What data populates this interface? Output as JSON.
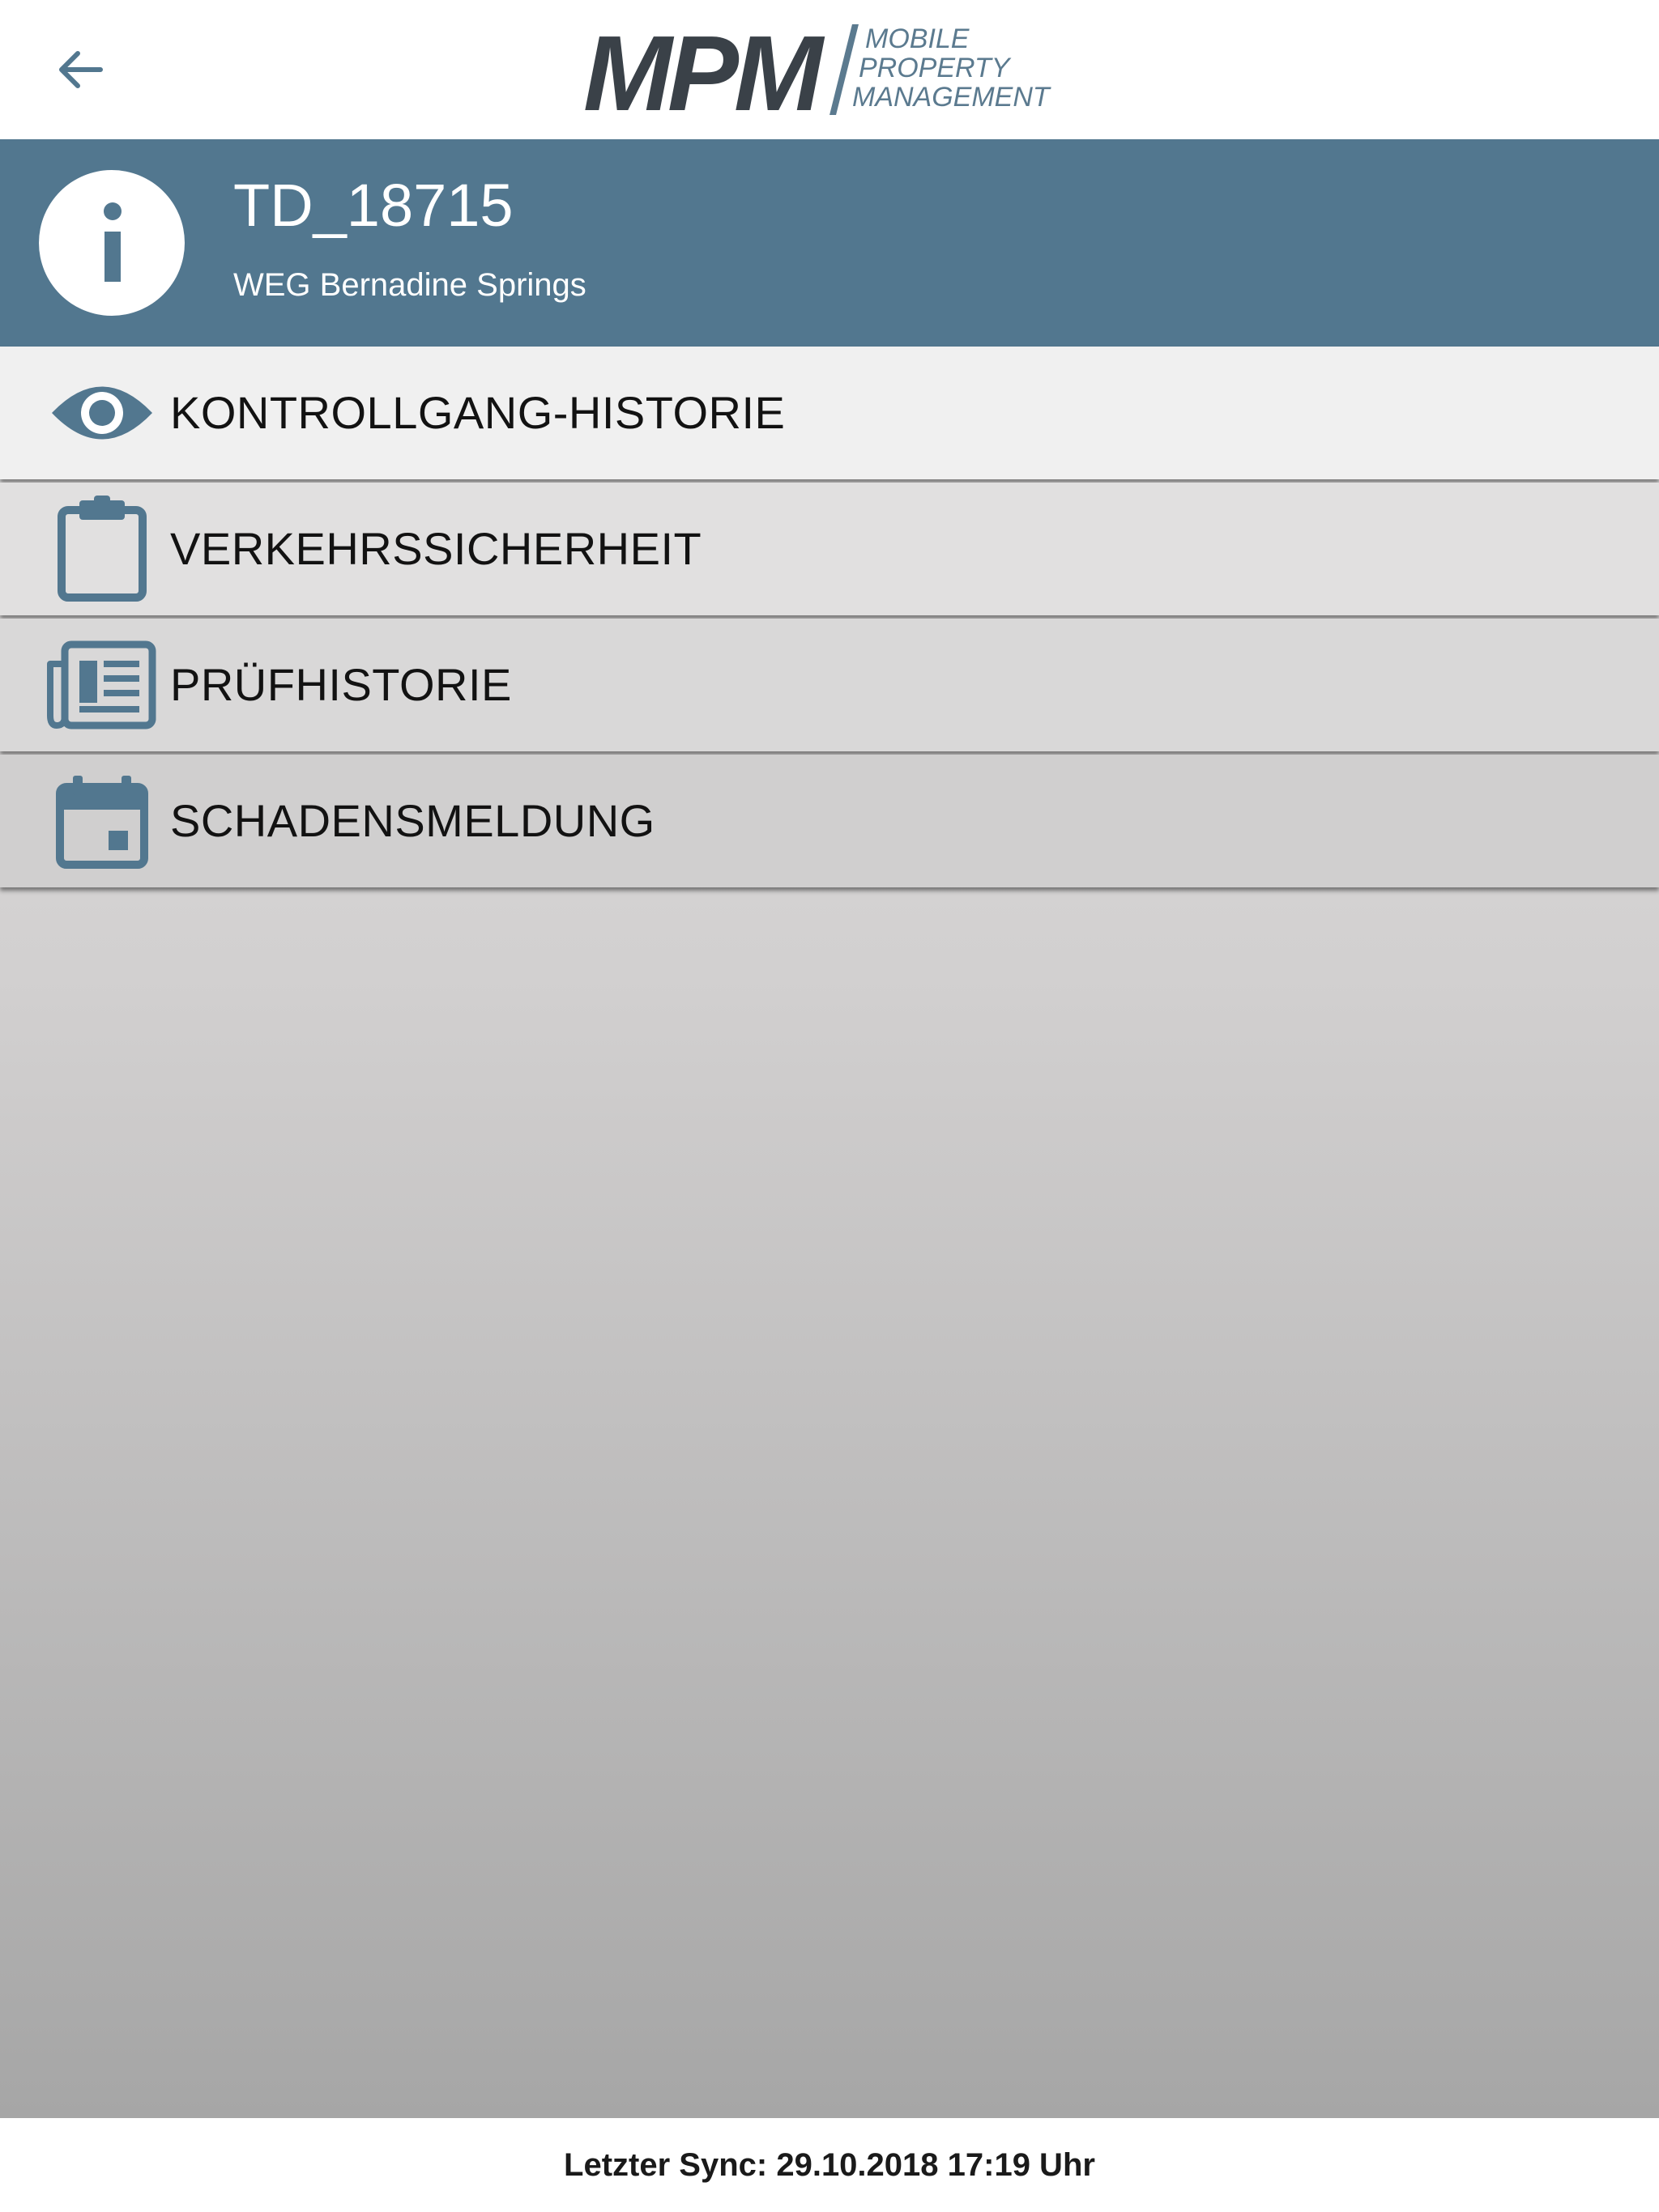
{
  "app": {
    "logo": {
      "main": "MPM",
      "line1": "MOBILE",
      "line2": "PROPERTY",
      "line3": "MANAGEMENT"
    },
    "back_icon": "arrow-left-icon"
  },
  "header": {
    "icon": "info-icon",
    "title": "TD_18715",
    "subtitle": "WEG Bernadine Springs"
  },
  "menu": {
    "items": [
      {
        "label": "KONTROLLGANG-HISTORIE",
        "icon": "eye-icon"
      },
      {
        "label": "VERKEHRSSICHERHEIT",
        "icon": "clipboard-icon"
      },
      {
        "label": "PRÜFHISTORIE",
        "icon": "newspaper-icon"
      },
      {
        "label": "SCHADENSMELDUNG",
        "icon": "calendar-icon"
      }
    ]
  },
  "footer": {
    "sync_text": "Letzter Sync: 29.10.2018 17:19 Uhr"
  },
  "colors": {
    "accent": "#52778f",
    "logo_dark": "#3a4148",
    "text_dark": "#121212"
  }
}
